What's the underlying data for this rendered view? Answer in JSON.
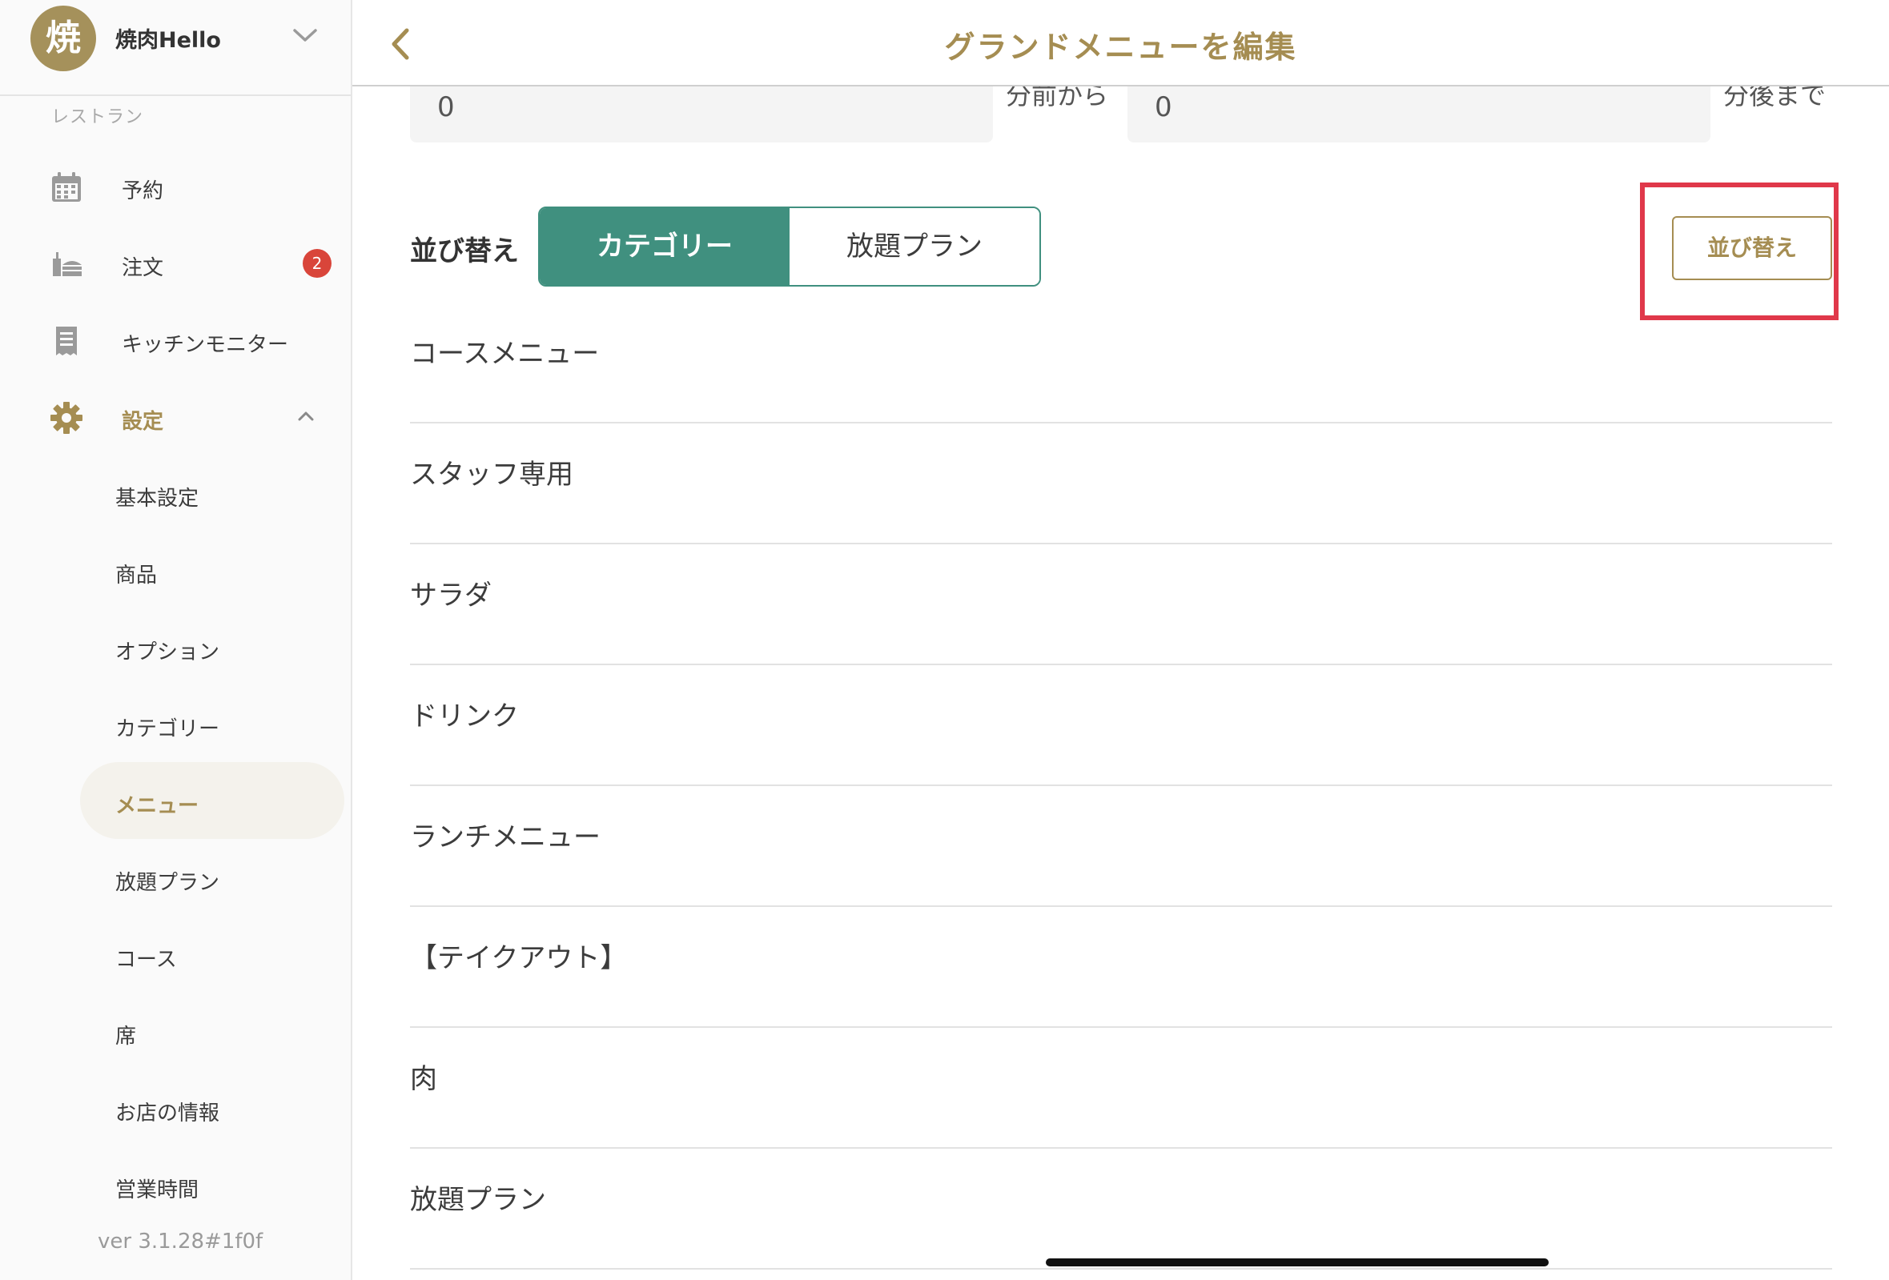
{
  "store": {
    "avatar_letter": "焼",
    "name": "焼肉Hello"
  },
  "sidebar": {
    "section_label": "レストラン",
    "nav": [
      {
        "label": "予約",
        "icon": "calendar-icon"
      },
      {
        "label": "注文",
        "icon": "order-tray-icon",
        "badge": "2"
      },
      {
        "label": "キッチンモニター",
        "icon": "receipt-icon"
      },
      {
        "label": "設定",
        "icon": "gear-icon",
        "expanded": true
      }
    ],
    "settings_items": [
      {
        "label": "基本設定"
      },
      {
        "label": "商品"
      },
      {
        "label": "オプション"
      },
      {
        "label": "カテゴリー"
      },
      {
        "label": "メニュー",
        "active": true
      },
      {
        "label": "放題プラン"
      },
      {
        "label": "コース"
      },
      {
        "label": "席"
      },
      {
        "label": "お店の情報"
      },
      {
        "label": "営業時間"
      }
    ],
    "version": "ver 3.1.28#1f0f"
  },
  "header": {
    "title": "グランドメニューを編集"
  },
  "time_range": {
    "from_value": "0",
    "from_suffix": "分前から",
    "to_value": "0",
    "to_suffix": "分後まで"
  },
  "sort": {
    "label": "並び替え",
    "segments": [
      {
        "label": "カテゴリー",
        "active": true
      },
      {
        "label": "放題プラン",
        "active": false
      }
    ],
    "reorder_button": "並び替え"
  },
  "categories": [
    "コースメニュー",
    "スタッフ専用",
    "サラダ",
    "ドリンク",
    "ランチメニュー",
    "【テイクアウト】",
    "肉",
    "放題プラン"
  ],
  "colors": {
    "gold": "#a58d52",
    "teal": "#40907f",
    "badge_red": "#d9453a",
    "highlight_red": "#e0384a"
  }
}
